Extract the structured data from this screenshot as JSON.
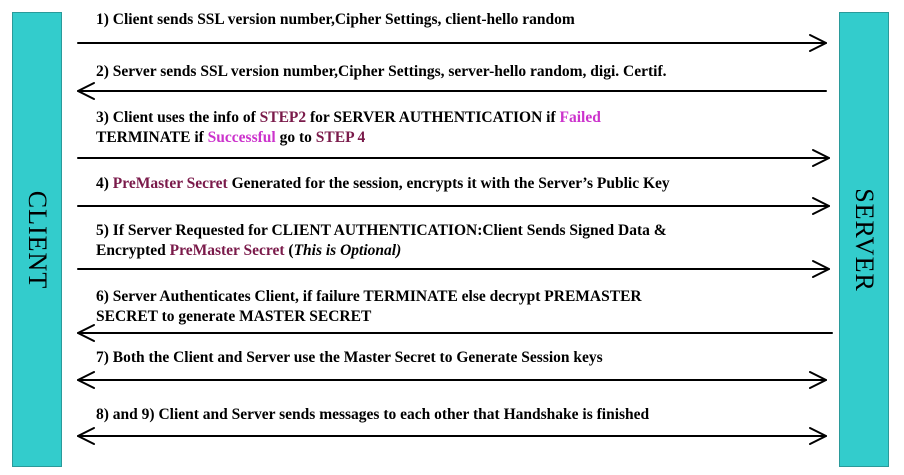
{
  "participants": {
    "client": "CLIENT",
    "server": "SERVER"
  },
  "colors": {
    "pillar": "#33cccc",
    "maroon": "#7a1a4a",
    "magenta": "#cc33cc",
    "arrow": "#000000"
  },
  "steps": [
    {
      "direction": "right",
      "text": "1) Client sends SSL version number,Cipher Settings, client-hello random"
    },
    {
      "direction": "left",
      "text": "2) Server sends SSL version number,Cipher Settings, server-hello random, digi. Certif."
    },
    {
      "direction": "right",
      "line1": {
        "a": "3) Client uses the info of ",
        "b": "STEP2",
        "c": " for SERVER AUTHENTICATION if ",
        "d": "Failed"
      },
      "line2": {
        "a": "TERMINATE if ",
        "b": "Successful",
        "c": " go to ",
        "d": "STEP 4"
      }
    },
    {
      "direction": "right",
      "a": "4) ",
      "b": "PreMaster Secret",
      "c": " Generated for the session, encrypts it with the Server’s Public Key"
    },
    {
      "direction": "right",
      "line1": "5) If Server Requested for CLIENT AUTHENTICATION:Client Sends Signed Data &",
      "line2": {
        "a": "Encrypted ",
        "b": "PreMaster Secret",
        "c": " (",
        "d": "This is Optional)"
      }
    },
    {
      "direction": "left",
      "line1": "6) Server Authenticates Client, if failure TERMINATE else decrypt PREMASTER",
      "line2": "SECRET to generate MASTER SECRET"
    },
    {
      "direction": "both",
      "text": "7) Both the Client and Server use the Master Secret to Generate Session keys"
    },
    {
      "direction": "both",
      "text": "8) and 9) Client and Server sends messages to each other that Handshake is finished"
    }
  ]
}
